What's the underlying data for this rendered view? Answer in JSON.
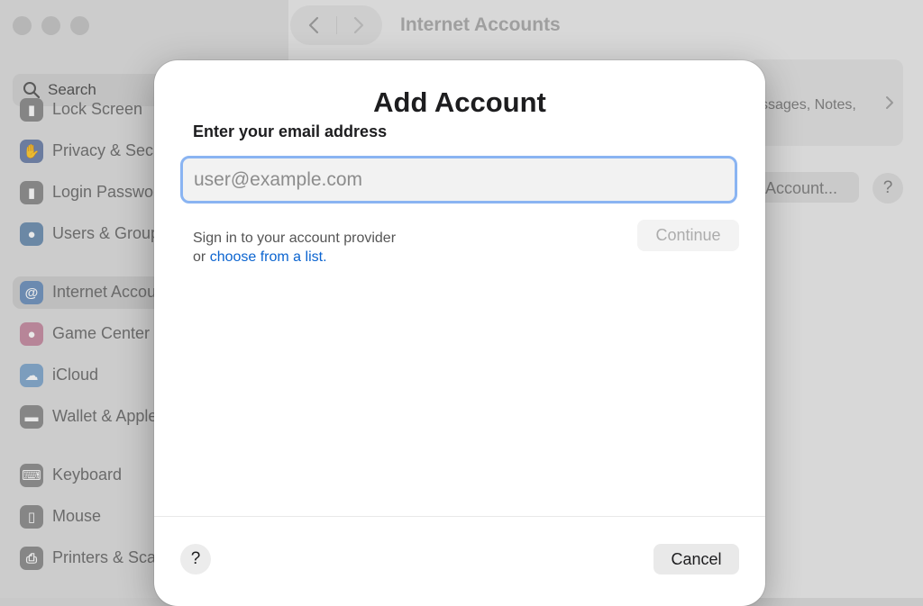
{
  "window": {
    "title": "Internet Accounts",
    "search_placeholder": "Search"
  },
  "sidebar": {
    "items": [
      {
        "label": "Lock Screen",
        "icon": "lock-screen-icon",
        "color": "#8a8a8a",
        "glyph": "🔒"
      },
      {
        "label": "Privacy & Security",
        "icon": "hand-icon",
        "color": "#6b7fa8",
        "glyph": "✋"
      },
      {
        "label": "Login Password",
        "icon": "lock-icon",
        "color": "#8a8a8a",
        "glyph": "🔒"
      },
      {
        "label": "Users & Groups",
        "icon": "users-icon",
        "color": "#6b8db0",
        "glyph": "👥"
      },
      {
        "label": "Internet Accounts",
        "icon": "at-icon",
        "color": "#6a90bd",
        "glyph": "@"
      },
      {
        "label": "Game Center",
        "icon": "game-center-icon",
        "color": "#c58aa0",
        "glyph": "●"
      },
      {
        "label": "iCloud",
        "icon": "cloud-icon",
        "color": "#7fa6cc",
        "glyph": "☁"
      },
      {
        "label": "Wallet & Apple Pay",
        "icon": "wallet-icon",
        "color": "#8b8b8b",
        "glyph": "▬"
      },
      {
        "label": "Keyboard",
        "icon": "keyboard-icon",
        "color": "#8b8b8b",
        "glyph": "⌨"
      },
      {
        "label": "Mouse",
        "icon": "mouse-icon",
        "color": "#8b8b8b",
        "glyph": "▯"
      },
      {
        "label": "Printers & Scanners",
        "icon": "printer-icon",
        "color": "#8b8b8b",
        "glyph": "⎙"
      }
    ]
  },
  "content": {
    "card_text": "ssages, Notes,",
    "add_account_label": "Account...",
    "help_label": "?"
  },
  "dialog": {
    "title": "Add Account",
    "field_label": "Enter your email address",
    "email_value": "",
    "email_placeholder": "user@example.com",
    "hint_prefix": "Sign in to your account provider",
    "hint_or": "or",
    "hint_link": "choose from a list.",
    "continue_label": "Continue",
    "help_label": "?",
    "cancel_label": "Cancel"
  },
  "colors": {
    "accent_link": "#0b64d0",
    "focus_ring": "#8ab4f2"
  }
}
